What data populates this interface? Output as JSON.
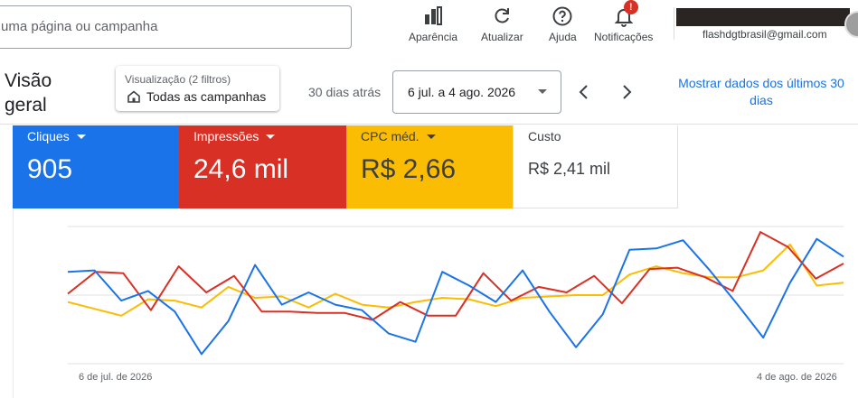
{
  "search": {
    "placeholder": "uma página ou campanha"
  },
  "toolbar": {
    "appearance": "Aparência",
    "refresh": "Atualizar",
    "help": "Ajuda",
    "notifications": "Notificações",
    "notification_badge": "!"
  },
  "account": {
    "email": "flashdgtbrasil@gmail.com"
  },
  "page": {
    "title": "Visão geral"
  },
  "view": {
    "label": "Visualização (2 filtros)",
    "value": "Todas as campanhas"
  },
  "date_range": {
    "label": "30 dias atrás",
    "value": "6 jul. a 4 ago. 2026",
    "show_link": "Mostrar dados dos últimos 30 dias"
  },
  "metrics": [
    {
      "label": "Cliques",
      "value": "905",
      "color": "#1a73e8"
    },
    {
      "label": "Impressões",
      "value": "24,6 mil",
      "color": "#d93025"
    },
    {
      "label": "CPC méd.",
      "value": "R$ 2,66",
      "color": "#fbbc04"
    },
    {
      "label": "Custo",
      "value": "R$ 2,41 mil",
      "color": "#ffffff"
    }
  ],
  "chart_data": {
    "type": "line",
    "x_start_label": "6 de jul. de 2026",
    "x_end_label": "4 de ago. de 2026",
    "y_axis_labels_shown": false,
    "grid": true,
    "series": [
      {
        "name": "Cliques",
        "color": "#1a73e8",
        "values": [
          0.67,
          0.68,
          0.46,
          0.53,
          0.38,
          0.07,
          0.31,
          0.72,
          0.43,
          0.52,
          0.43,
          0.39,
          0.22,
          0.16,
          0.67,
          0.57,
          0.45,
          0.68,
          0.38,
          0.12,
          0.36,
          0.83,
          0.84,
          0.9,
          0.68,
          0.44,
          0.19,
          0.59,
          0.91,
          0.78
        ]
      },
      {
        "name": "Impressões",
        "color": "#d93025",
        "values": [
          0.51,
          0.67,
          0.66,
          0.39,
          0.71,
          0.52,
          0.64,
          0.38,
          0.38,
          0.37,
          0.37,
          0.32,
          0.45,
          0.35,
          0.35,
          0.66,
          0.46,
          0.56,
          0.52,
          0.64,
          0.44,
          0.69,
          0.7,
          0.63,
          0.53,
          0.96,
          0.85,
          0.62,
          0.73
        ]
      },
      {
        "name": "CPC méd.",
        "color": "#fbbc04",
        "values": [
          0.45,
          0.4,
          0.35,
          0.47,
          0.46,
          0.41,
          0.56,
          0.48,
          0.49,
          0.41,
          0.51,
          0.43,
          0.41,
          0.45,
          0.48,
          0.47,
          0.42,
          0.48,
          0.49,
          0.5,
          0.5,
          0.65,
          0.71,
          0.66,
          0.63,
          0.63,
          0.68,
          0.87,
          0.57,
          0.59
        ]
      }
    ]
  }
}
